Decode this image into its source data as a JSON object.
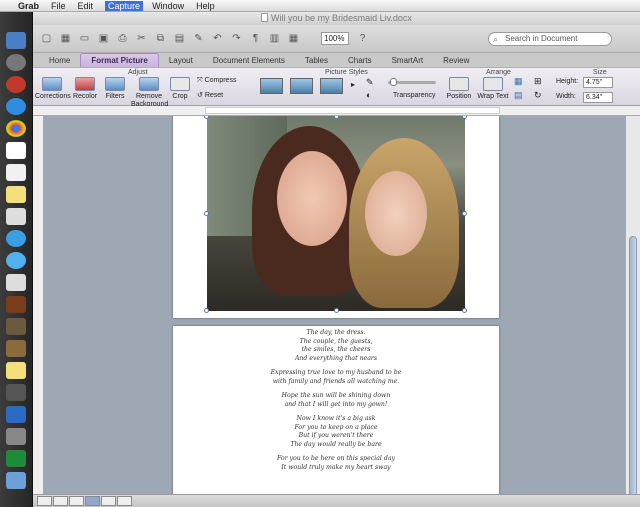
{
  "menubar": {
    "app": "Grab",
    "items": [
      "File",
      "Edit",
      "Capture",
      "Window",
      "Help"
    ]
  },
  "window": {
    "title": "Will you be my Bridesmaid Liv.docx"
  },
  "toolbar": {
    "zoom": "100%",
    "search_placeholder": "Search in Document"
  },
  "tabs": [
    "Home",
    "Format Picture",
    "Layout",
    "Document Elements",
    "Tables",
    "Charts",
    "SmartArt",
    "Review"
  ],
  "ribbon": {
    "groups": {
      "adjust": "Adjust",
      "picture_styles": "Picture Styles",
      "arrange": "Arrange",
      "size": "Size"
    },
    "buttons": {
      "corrections": "Corrections",
      "recolor": "Recolor",
      "filters": "Filters",
      "remove_background": "Remove Background",
      "crop": "Crop",
      "compress": "Compress",
      "reset": "Reset",
      "transparency": "Transparency",
      "position": "Position",
      "wrap_text": "Wrap Text"
    },
    "size": {
      "height_label": "Height:",
      "height_value": "4.75\"",
      "width_label": "Width:",
      "width_value": "6.34\""
    }
  },
  "poem": [
    "The day, the dress.",
    "The couple, the guests,",
    "the smiles, the cheers",
    "And everything that nears",
    "",
    "Expressing true love to my husband to be",
    "with family and friends all watching me.",
    "",
    "Hope the sun will be shining down",
    "and that I will get into my gown!",
    "",
    "Now I know it's a big ask",
    "For you to keep on a place",
    "But if you weren't there",
    "The day would really be bare",
    "",
    "For you to be here on this special day",
    "It would truly make my heart sway"
  ],
  "colors": {
    "tab_accent": "#c8b3dd",
    "doc_background": "#9ea8b4"
  }
}
